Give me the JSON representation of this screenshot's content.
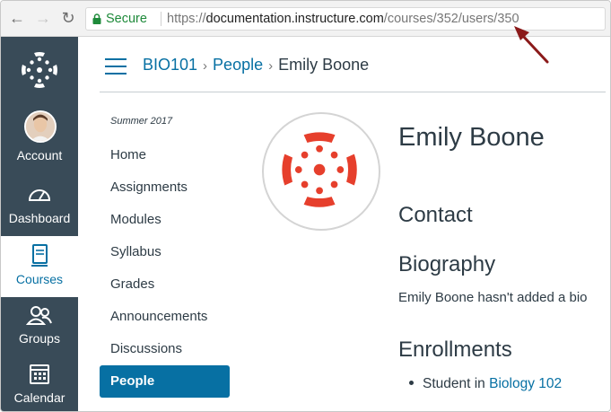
{
  "browser": {
    "secure_label": "Secure",
    "url_scheme": "https://",
    "url_host": "documentation.instructure.com",
    "url_path": "/courses/352/users/350"
  },
  "global_nav": {
    "items": [
      {
        "label": "Account"
      },
      {
        "label": "Dashboard"
      },
      {
        "label": "Courses"
      },
      {
        "label": "Groups"
      },
      {
        "label": "Calendar"
      }
    ]
  },
  "breadcrumb": {
    "course": "BIO101",
    "section": "People",
    "current": "Emily Boone"
  },
  "course_nav": {
    "term": "Summer 2017",
    "items": [
      {
        "label": "Home"
      },
      {
        "label": "Assignments"
      },
      {
        "label": "Modules"
      },
      {
        "label": "Syllabus"
      },
      {
        "label": "Grades"
      },
      {
        "label": "Announcements"
      },
      {
        "label": "Discussions"
      },
      {
        "label": "People"
      }
    ]
  },
  "profile": {
    "name": "Emily Boone",
    "contact_heading": "Contact",
    "biography_heading": "Biography",
    "biography_text": "Emily Boone hasn't added a bio",
    "enrollments_heading": "Enrollments",
    "enrollment_role": "Student in",
    "enrollment_course": "Biology 102"
  },
  "colors": {
    "nav_bg": "#394b58",
    "link": "#0770a3",
    "canvas_red": "#e63f2c",
    "secure_green": "#1e8a3a",
    "annotation_arrow": "#8b1a1a"
  }
}
